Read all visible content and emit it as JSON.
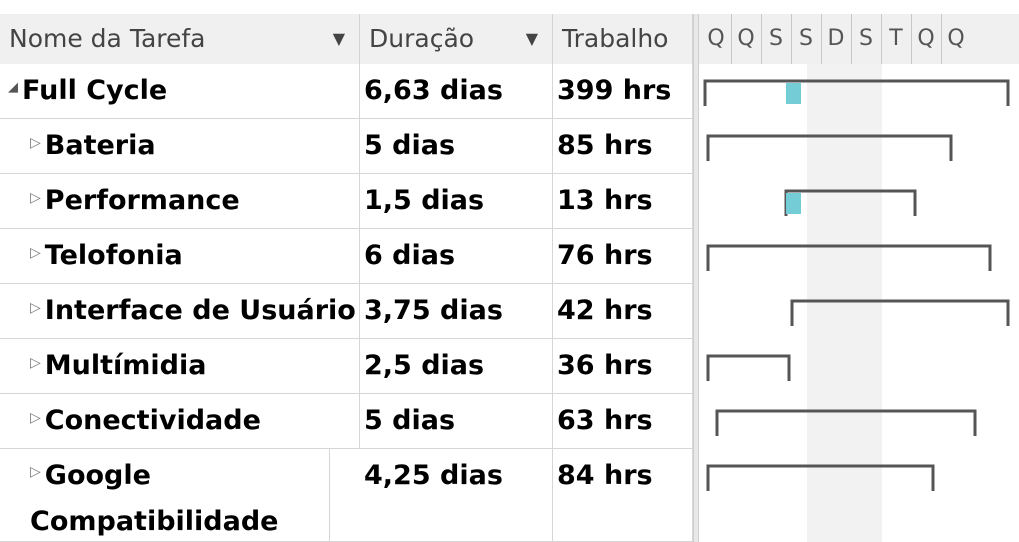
{
  "columns": {
    "name": "Nome da Tarefa",
    "duration": "Duração",
    "work": "Trabalho"
  },
  "icons": {
    "dropdown": "chevron-down-icon",
    "expanded": "collapse-triangle-icon",
    "collapsed": "expand-triangle-icon"
  },
  "timescale_days": [
    "Q",
    "Q",
    "S",
    "S",
    "D",
    "S",
    "T",
    "Q",
    "Q"
  ],
  "colors": {
    "progress": "#74cdd6",
    "bracket": "#555555",
    "weekend_shade": "#f2f2f2",
    "header_bg": "#f0f0f0"
  },
  "tasks": [
    {
      "name": "Full Cycle",
      "duration": "6,63 dias",
      "work": "399 hrs",
      "summary": true,
      "expanded": true,
      "start_day": 0.2,
      "end_day": 10.3,
      "progress_day": 2.9,
      "progress_end_day": 3.4
    },
    {
      "name": "Bateria",
      "duration": "5 dias",
      "work": "85 hrs",
      "summary": false,
      "start_day": 0.3,
      "end_day": 8.4
    },
    {
      "name": "Performance",
      "duration": "1,5 dias",
      "work": "13 hrs",
      "summary": false,
      "start_day": 2.9,
      "end_day": 7.2,
      "progress_day": 2.9,
      "progress_end_day": 3.4
    },
    {
      "name": "Telofonia",
      "duration": "6 dias",
      "work": "76 hrs",
      "summary": false,
      "start_day": 0.3,
      "end_day": 9.7
    },
    {
      "name": "Interface de Usuário",
      "duration": "3,75 dias",
      "work": "42 hrs",
      "summary": false,
      "start_day": 3.1,
      "end_day": 10.3
    },
    {
      "name": "Multímidia",
      "duration": "2,5 dias",
      "work": "36 hrs",
      "summary": false,
      "start_day": 0.3,
      "end_day": 3.0
    },
    {
      "name": "Conectividade",
      "duration": "5 dias",
      "work": "63 hrs",
      "summary": false,
      "start_day": 0.6,
      "end_day": 9.2
    },
    {
      "name": "Google Compatibilidade",
      "duration": "4,25 dias",
      "work": "84 hrs",
      "summary": false,
      "start_day": 0.3,
      "end_day": 7.8
    }
  ]
}
